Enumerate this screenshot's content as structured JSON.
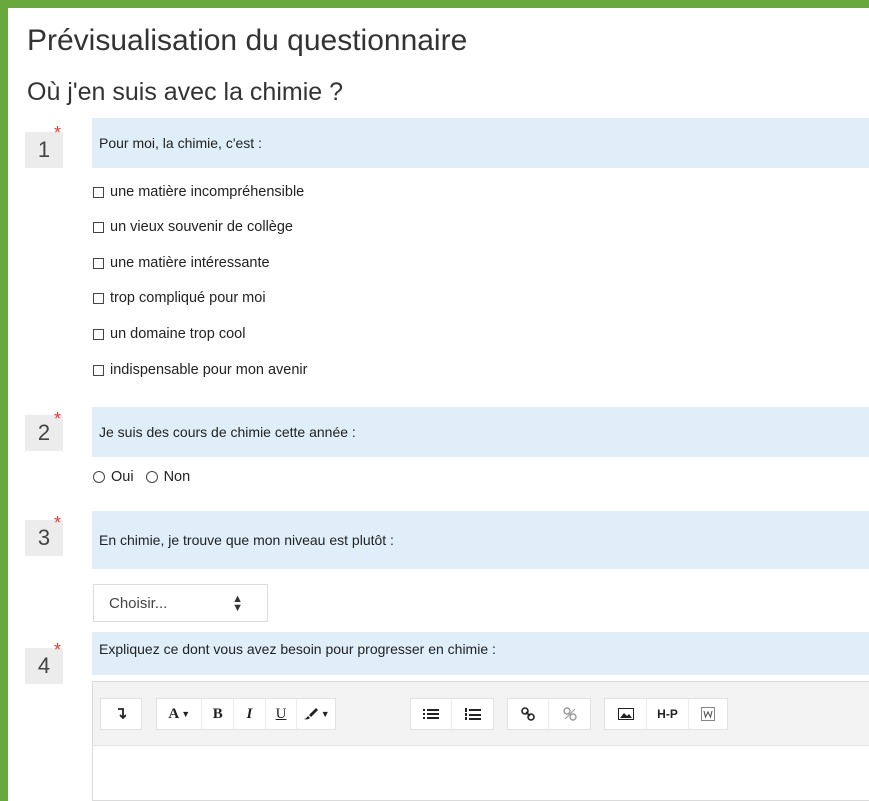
{
  "header": {
    "page_title": "Prévisualisation du questionnaire",
    "survey_title": "Où j'en suis avec la chimie ?"
  },
  "required_marker": "*",
  "questions": [
    {
      "number": "1",
      "text": "Pour moi, la chimie, c'est :",
      "type": "checkbox",
      "options": [
        "une matière incompréhensible",
        "un vieux souvenir de collège",
        "une matière intéressante",
        "trop compliqué pour moi",
        "un domaine trop cool",
        "indispensable pour mon avenir"
      ]
    },
    {
      "number": "2",
      "text": "Je suis des cours de chimie cette année :",
      "type": "radio",
      "options": [
        "Oui",
        "Non"
      ]
    },
    {
      "number": "3",
      "text": "En chimie, je trouve que mon niveau est plutôt :",
      "type": "select",
      "selected": "Choisir..."
    },
    {
      "number": "4",
      "text": "Expliquez ce dont vous avez besoin pour progresser en chimie :",
      "type": "richtext",
      "toolbar": {
        "font_label": "A",
        "bold": "B",
        "italic": "I",
        "underline": "U",
        "h5p": "H-P"
      }
    }
  ],
  "colors": {
    "frame": "#69a83c",
    "question_bar": "#e0eefa",
    "required": "#e03a3a"
  },
  "icons": [
    "collapse-icon",
    "font-color-icon",
    "bold-icon",
    "italic-icon",
    "underline-icon",
    "brush-icon",
    "bullet-list-icon",
    "numbered-list-icon",
    "link-icon",
    "unlink-icon",
    "image-icon",
    "h5p-icon",
    "word-paste-icon"
  ]
}
